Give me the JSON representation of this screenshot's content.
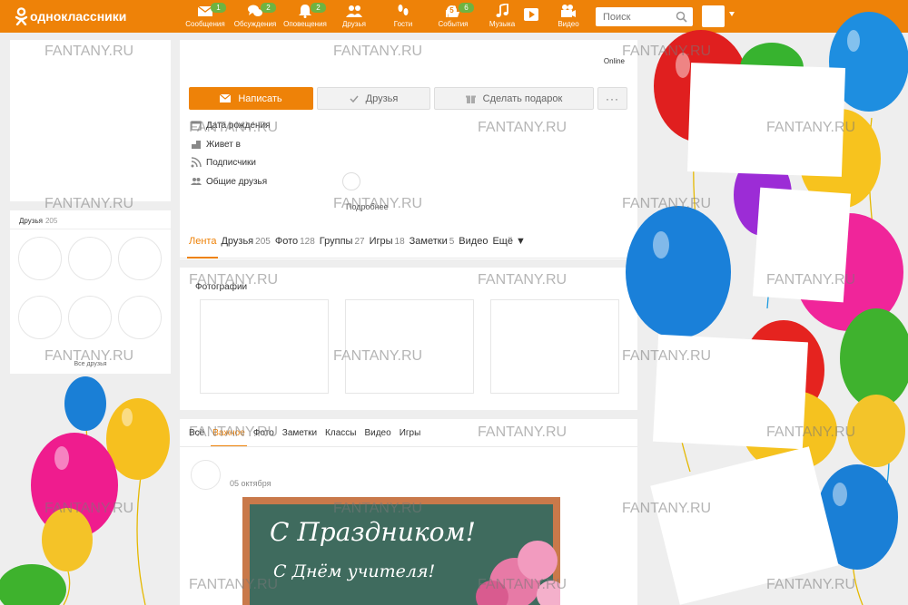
{
  "topbar": {
    "logo_text": "одноклассники",
    "nav": [
      {
        "icon": "envelope-icon",
        "label": "Сообщения",
        "badge": "1"
      },
      {
        "icon": "chat-bubbles-icon",
        "label": "Обсуждения",
        "badge": "2"
      },
      {
        "icon": "bell-icon",
        "label": "Оповещения",
        "badge": "2"
      },
      {
        "icon": "people-icon",
        "label": "Друзья",
        "badge": ""
      },
      {
        "icon": "footprints-icon",
        "label": "Гости",
        "badge": ""
      },
      {
        "icon": "thumbs-up-icon",
        "label": "События",
        "badge": "6",
        "badge_secondary": "5"
      },
      {
        "icon": "music-note-icon",
        "label": "Музыка",
        "badge": ""
      },
      {
        "icon": "play-icon",
        "label": "",
        "badge": ""
      },
      {
        "icon": "video-camera-icon",
        "label": "Видео",
        "badge": ""
      }
    ],
    "search_placeholder": "Поиск"
  },
  "left": {
    "friends_title": "Друзья",
    "friends_count": "205",
    "all_friends": "Все друзья"
  },
  "profile": {
    "status": "Online",
    "buttons": {
      "write": "Написать",
      "friends": "Друзья",
      "gift": "Сделать подарок",
      "more": "···"
    },
    "info": [
      {
        "icon": "calendar-icon",
        "label": "Дата рождения"
      },
      {
        "icon": "house-icon",
        "label": "Живет в"
      },
      {
        "icon": "rss-icon",
        "label": "Подписчики"
      },
      {
        "icon": "group-icon",
        "label": "Общие друзья"
      }
    ],
    "more_link": "Подробнее",
    "tabs": [
      {
        "label": "Лента",
        "count": ""
      },
      {
        "label": "Друзья",
        "count": "205"
      },
      {
        "label": "Фото",
        "count": "128"
      },
      {
        "label": "Группы",
        "count": "27"
      },
      {
        "label": "Игры",
        "count": "18"
      },
      {
        "label": "Заметки",
        "count": "5"
      },
      {
        "label": "Видео",
        "count": ""
      },
      {
        "label": "Ещё ▼",
        "count": ""
      }
    ]
  },
  "photos": {
    "title": "Фотографии"
  },
  "feed": {
    "tabs": [
      "Всё",
      "Важное",
      "Фото",
      "Заметки",
      "Классы",
      "Видео",
      "Игры"
    ],
    "date": "05 октября",
    "image_text_line1": "С Праздником!",
    "image_text_line2": "С Днём учителя!"
  },
  "watermark": "FANTANY.RU",
  "colors": {
    "brand": "#ee8208",
    "badge": "#6fb341",
    "page_bg": "#eeeeee"
  }
}
